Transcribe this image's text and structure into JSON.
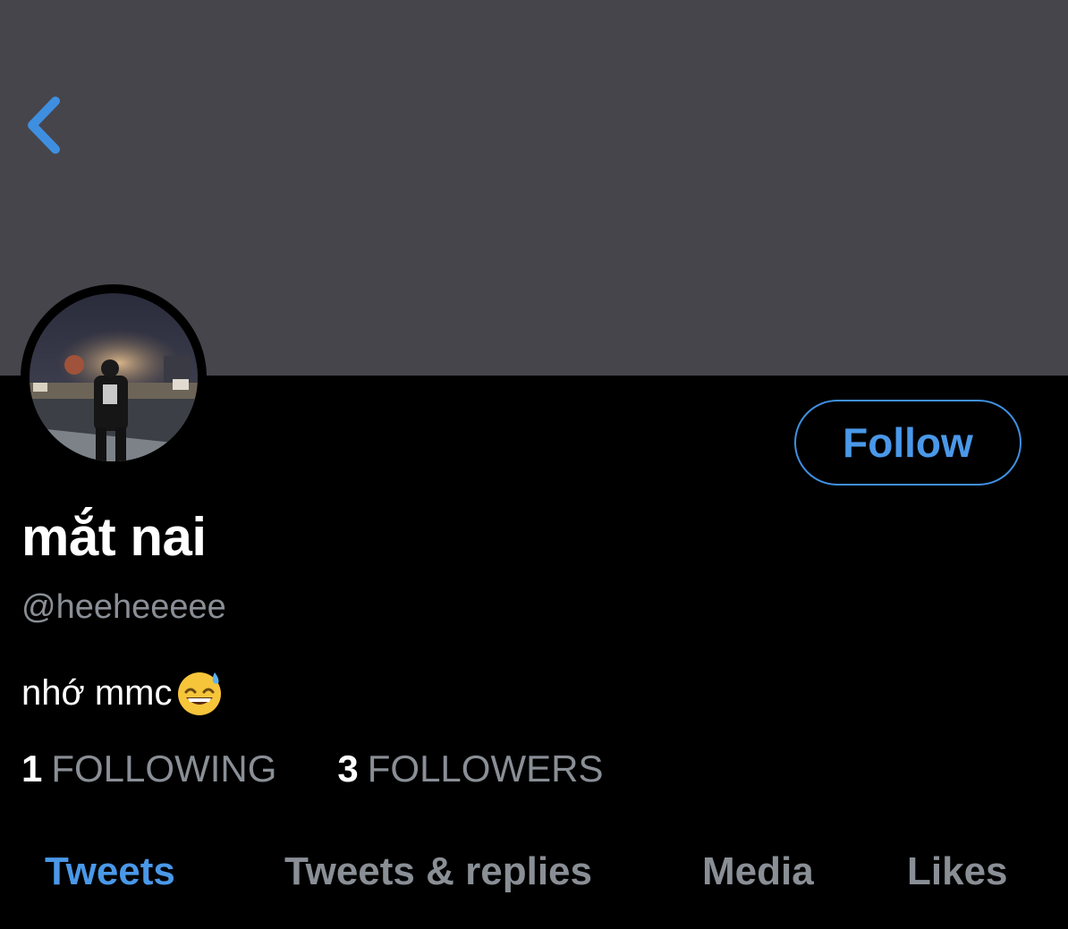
{
  "colors": {
    "banner": "#46454b",
    "background": "#000000",
    "accent": "#4a98e8",
    "muted_text": "#8a8f96"
  },
  "icons": {
    "back": "chevron-left-icon",
    "bio_emoji": "grinning-sweat-emoji"
  },
  "profile": {
    "display_name": "mắt nai",
    "handle": "@heeheeeee",
    "bio": "nhớ mmc"
  },
  "actions": {
    "follow_label": "Follow"
  },
  "stats": {
    "following_count": "1",
    "following_label": "FOLLOWING",
    "followers_count": "3",
    "followers_label": "FOLLOWERS"
  },
  "tabs": [
    {
      "label": "Tweets",
      "active": true
    },
    {
      "label": "Tweets & replies",
      "active": false
    },
    {
      "label": "Media",
      "active": false
    },
    {
      "label": "Likes",
      "active": false
    }
  ]
}
